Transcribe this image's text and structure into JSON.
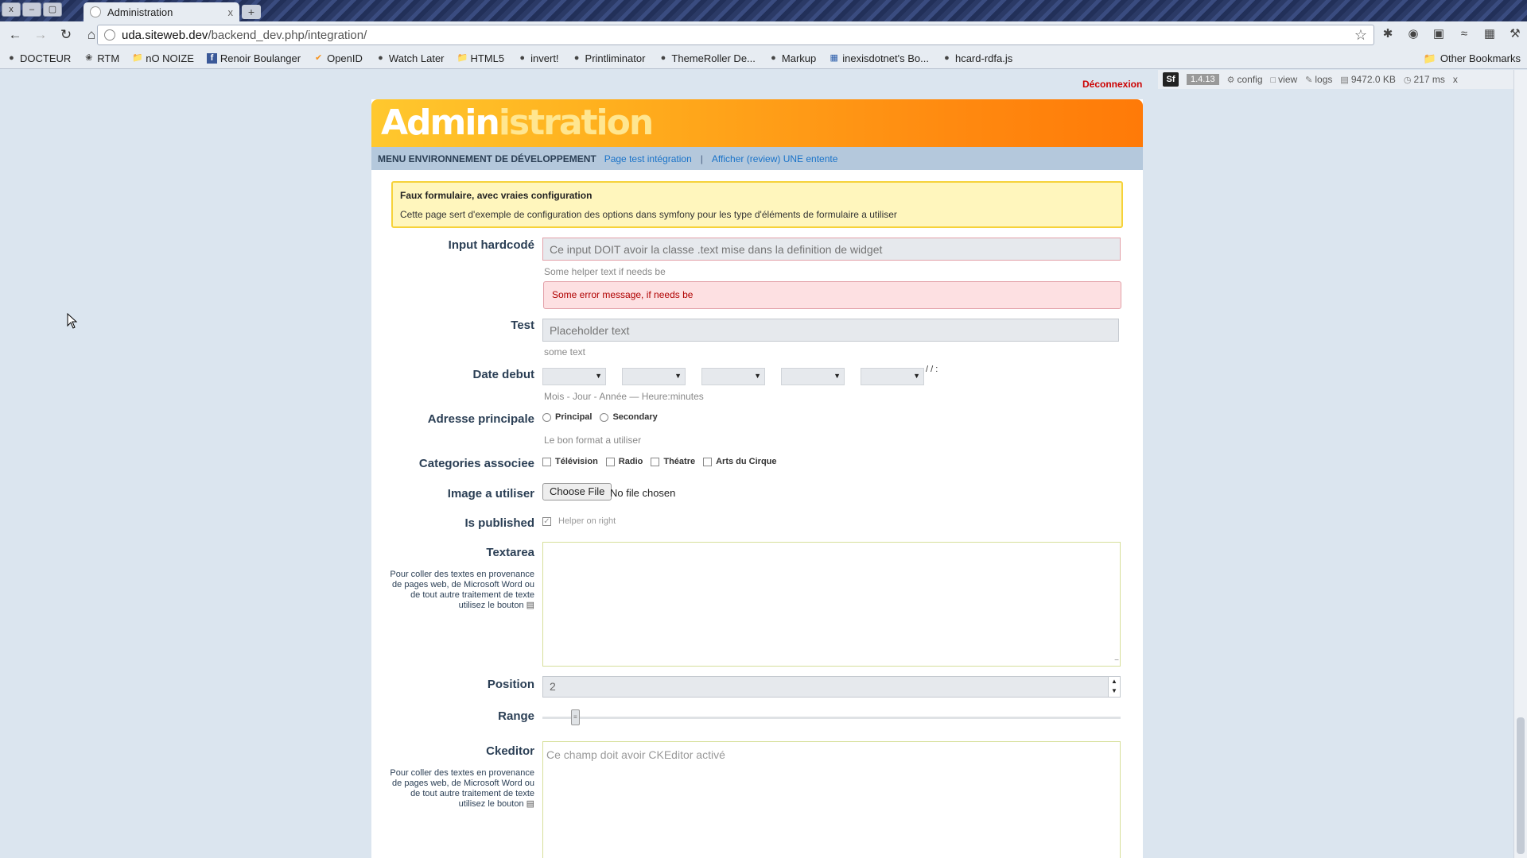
{
  "browser": {
    "window_buttons": [
      "x",
      "–",
      "▢"
    ],
    "tab_title": "Administration",
    "tab_close": "x",
    "new_tab": "+",
    "url_host": "uda.siteweb.dev",
    "url_path": "/backend_dev.php/integration/",
    "bookmarks": [
      {
        "label": "DOCTEUR",
        "icon": "circle-icon"
      },
      {
        "label": "RTM",
        "icon": "bug-icon"
      },
      {
        "label": "nO NOIZE",
        "icon": "folder-icon"
      },
      {
        "label": "Renoir Boulanger",
        "icon": "facebook-icon"
      },
      {
        "label": "OpenID",
        "icon": "openid-icon"
      },
      {
        "label": "Watch Later",
        "icon": "circle-icon"
      },
      {
        "label": "HTML5",
        "icon": "folder-icon"
      },
      {
        "label": "invert!",
        "icon": "circle-icon"
      },
      {
        "label": "Printliminator",
        "icon": "circle-icon"
      },
      {
        "label": "ThemeRoller De...",
        "icon": "circle-icon"
      },
      {
        "label": "Markup",
        "icon": "circle-icon"
      },
      {
        "label": "inexisdotnet's Bo...",
        "icon": "delicious-icon"
      },
      {
        "label": "hcard-rdfa.js",
        "icon": "circle-icon"
      }
    ],
    "other_bookmarks": "Other Bookmarks"
  },
  "debug": {
    "logo": "Sf",
    "version": "1.4.13",
    "config": "config",
    "view": "view",
    "logs": "logs",
    "memory": "9472.0 KB",
    "time": "217 ms",
    "close": "x"
  },
  "header": {
    "logout": "Déconnexion",
    "title_part1": "Admin",
    "title_part2": "istration"
  },
  "menu": {
    "title": "MENU ENVIRONNEMENT DE DÉVELOPPEMENT",
    "link1": "Page test intégration",
    "separator": "|",
    "link2": "Afficher (review) UNE entente"
  },
  "notice": {
    "title": "Faux formulaire, avec vraies configuration",
    "text": "Cette page sert d'exemple de configuration des options dans symfony pour les type d'éléments de formulaire a utiliser"
  },
  "form": {
    "input_hardcode": {
      "label": "Input hardcodé",
      "placeholder": "Ce input DOIT avoir la classe .text mise dans la definition de widget",
      "helper": "Some helper text if needs be",
      "error": "Some error message, if needs be"
    },
    "test": {
      "label": "Test",
      "placeholder": "Placeholder text",
      "helper": "some text"
    },
    "date_debut": {
      "label": "Date debut",
      "separator": "/ / :",
      "helper": "Mois - Jour - Année — Heure:minutes"
    },
    "adresse": {
      "label": "Adresse principale",
      "options": [
        "Principal",
        "Secondary"
      ],
      "helper": "Le bon format a utiliser"
    },
    "categories": {
      "label": "Categories associee",
      "options": [
        "Télévision",
        "Radio",
        "Théatre",
        "Arts du Cirque"
      ]
    },
    "image": {
      "label": "Image a utiliser",
      "button": "Choose File",
      "status": "No file chosen"
    },
    "published": {
      "label": "Is published",
      "helper": "Helper on right"
    },
    "textarea": {
      "label": "Textarea",
      "help_lines": [
        "Pour coller des textes en provenance",
        "de pages web, de Microsoft Word ou",
        "de tout autre traitement de texte",
        "utilisez le bouton"
      ]
    },
    "position": {
      "label": "Position",
      "value": "2"
    },
    "range": {
      "label": "Range",
      "value_fraction": 0.05
    },
    "ckeditor": {
      "label": "Ckeditor",
      "placeholder": "Ce champ doit avoir CKEditor activé",
      "help_lines": [
        "Pour coller des textes en provenance",
        "de pages web, de Microsoft Word ou",
        "de tout autre traitement de texte",
        "utilisez le bouton"
      ]
    }
  }
}
